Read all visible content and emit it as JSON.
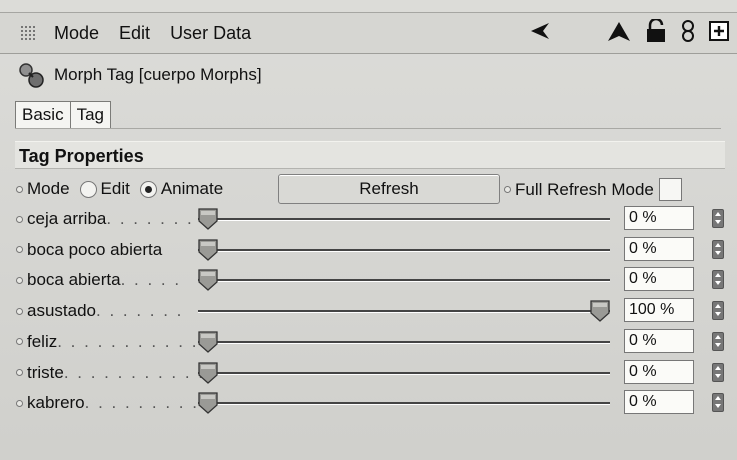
{
  "menu": {
    "items": [
      "Mode",
      "Edit",
      "User Data"
    ]
  },
  "toolbar_icons": [
    "back-arrow-icon",
    "up-arrow-icon",
    "lock-open-icon",
    "link-icon",
    "new-window-icon"
  ],
  "header": {
    "title": "Morph Tag [cuerpo Morphs]",
    "icon": "morph-tag-icon"
  },
  "tabs": [
    "Basic",
    "Tag"
  ],
  "section": {
    "title": "Tag Properties"
  },
  "mode_row": {
    "label": "Mode",
    "options": [
      "Edit",
      "Animate"
    ],
    "selected": "Animate",
    "refresh_label": "Refresh",
    "full_refresh_label": "Full Refresh Mode",
    "full_refresh_checked": false
  },
  "sliders": [
    {
      "label": "ceja arriba",
      "dots": ". . . . . . .",
      "value": "0 %",
      "fraction": 0.0,
      "show_thumb": true
    },
    {
      "label": "boca poco abierta",
      "dots": "",
      "value": "0 %",
      "fraction": 0.0,
      "show_thumb": true
    },
    {
      "label": "boca abierta",
      "dots": ". . . . .",
      "value": "0 %",
      "fraction": 0.0,
      "show_thumb": true
    },
    {
      "label": "asustado",
      "dots": ". . . . . . .",
      "value": "100 %",
      "fraction": 1.0,
      "show_thumb": true
    },
    {
      "label": "feliz",
      "dots": ". . . . . . . . . . . .",
      "value": "0 %",
      "fraction": 0.0,
      "show_thumb": true
    },
    {
      "label": "triste",
      "dots": ". . . . . . . . . . .",
      "value": "0 %",
      "fraction": 0.0,
      "show_thumb": true
    },
    {
      "label": "kabrero",
      "dots": ". . . . . . . . .",
      "value": "0 %",
      "fraction": 0.0,
      "show_thumb": true
    }
  ]
}
